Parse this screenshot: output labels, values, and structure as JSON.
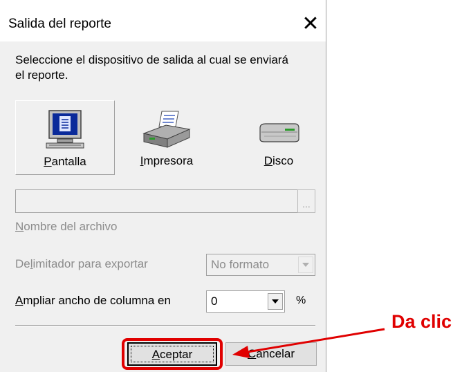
{
  "dialog": {
    "title": "Salida del reporte",
    "close_glyph": "✕",
    "instruction": "Seleccione el dispositivo de salida al cual se enviará el reporte."
  },
  "devices": [
    {
      "label_ul": "P",
      "label_rest": "antalla",
      "icon": "monitor-icon",
      "selected": true
    },
    {
      "label_ul": "I",
      "label_rest": "mpresora",
      "icon": "printer-icon",
      "selected": false
    },
    {
      "label_ul": "D",
      "label_rest": "isco",
      "icon": "disk-drive-icon",
      "selected": false
    }
  ],
  "file": {
    "value": "",
    "browse_label": "...",
    "label_ul": "N",
    "label_rest": "ombre del archivo"
  },
  "delimiter": {
    "label_ul": "D",
    "label_mid": "e",
    "label_ul2": "l",
    "label_rest": "imitador para exportar",
    "value": "No formato"
  },
  "widen": {
    "label_ul": "A",
    "label_rest": "mpliar ancho de columna en",
    "value": "0",
    "unit": "%"
  },
  "buttons": {
    "accept_ul": "A",
    "accept_rest": "ceptar",
    "cancel_ul": "C",
    "cancel_rest": "ancelar"
  },
  "annotation": {
    "text": "Da clic",
    "color": "#e00000"
  },
  "colors": {
    "dialog_bg": "#f0f0f0",
    "monitor_screen": "#0a2a9a"
  }
}
